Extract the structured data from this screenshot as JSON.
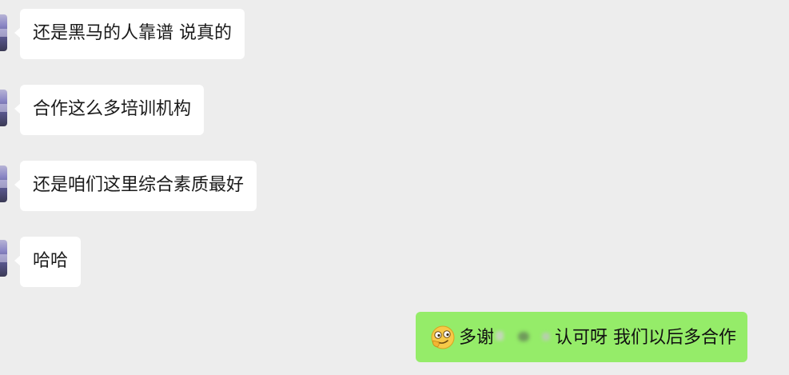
{
  "chat": {
    "messages": [
      {
        "sender": "other",
        "text": "还是黑马的人靠谱  说真的"
      },
      {
        "sender": "other",
        "text": "合作这么多培训机构"
      },
      {
        "sender": "other",
        "text": "还是咱们这里综合素质最好"
      },
      {
        "sender": "other",
        "text": "哈哈"
      }
    ],
    "reply": {
      "sender": "me",
      "emoji": "smirk-face-emoji",
      "text_before": "多谢",
      "text_after": "认可呀 我们以后多合作"
    }
  },
  "colors": {
    "background": "#ededed",
    "received_bubble": "#ffffff",
    "sent_bubble": "#95ec69"
  }
}
